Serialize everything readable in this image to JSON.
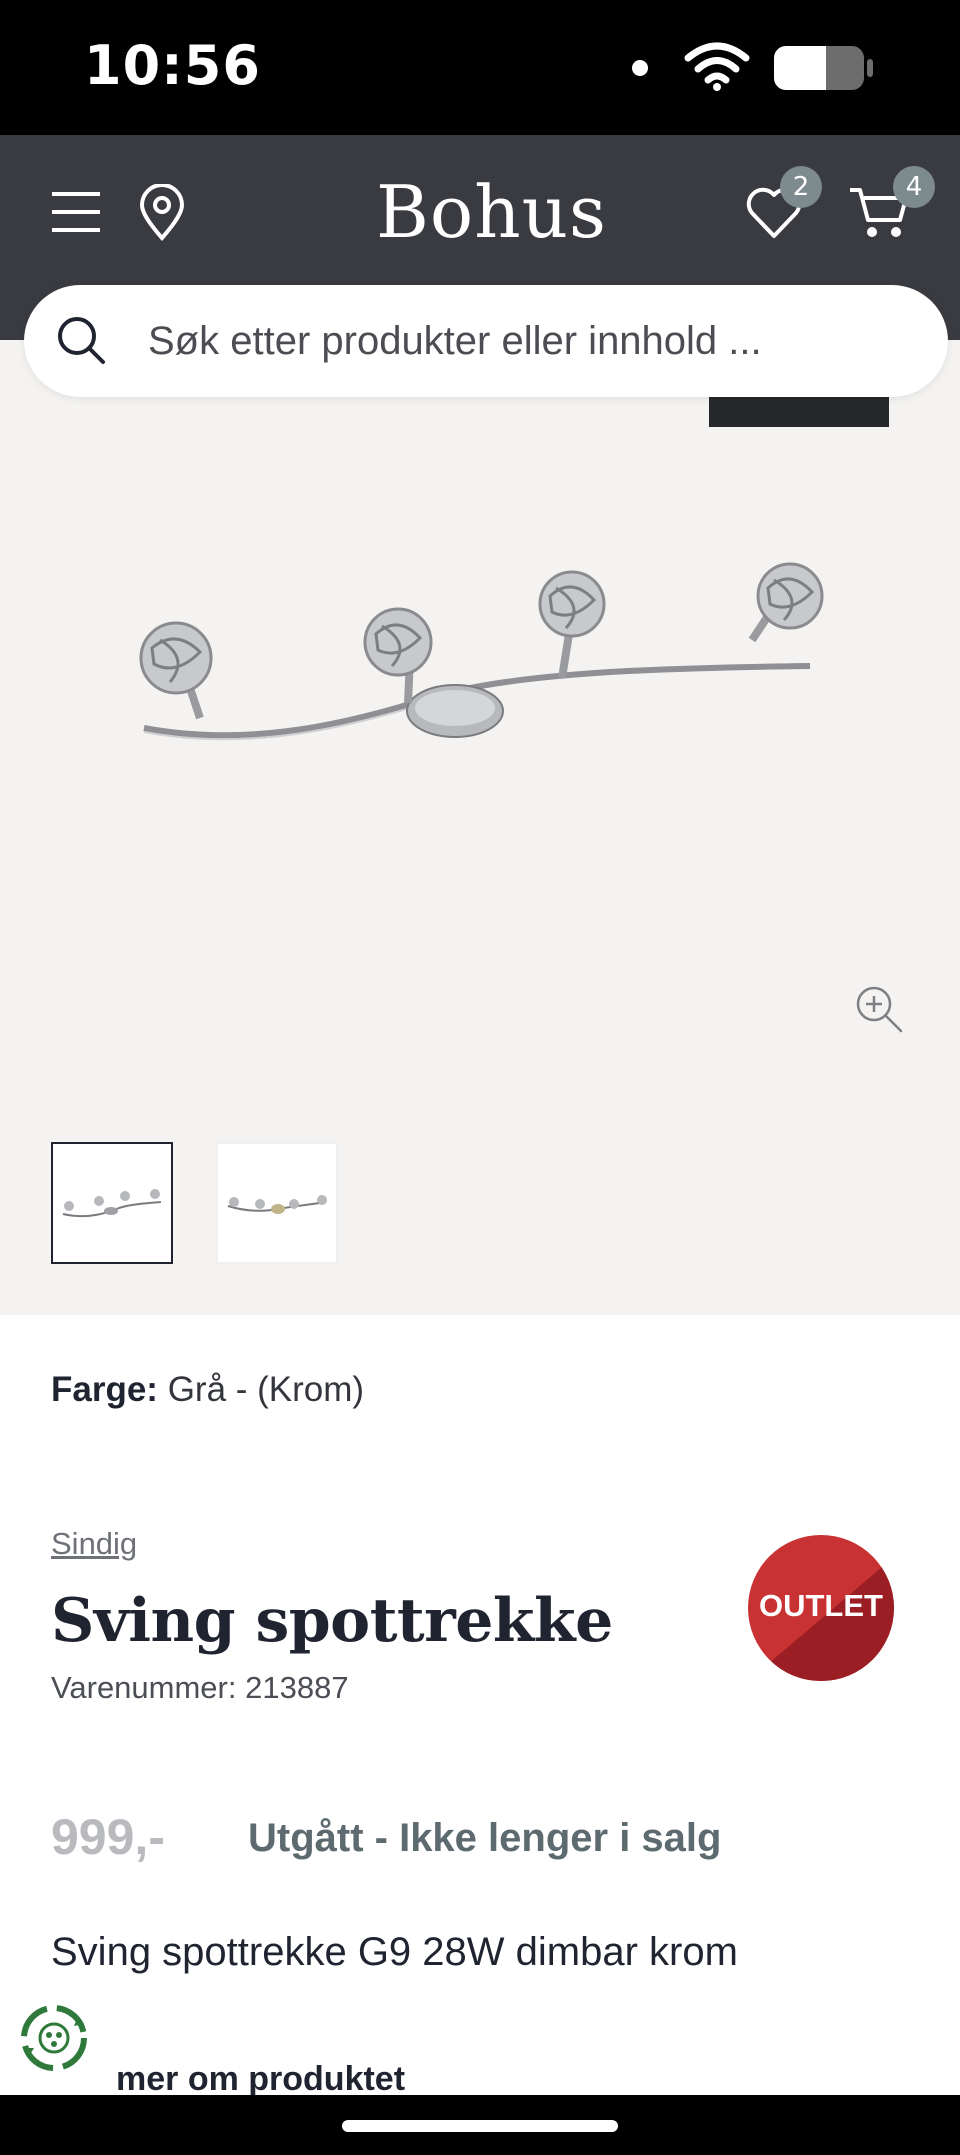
{
  "status_bar": {
    "time": "10:56"
  },
  "header": {
    "logo": "Bohus",
    "wishlist_count": "2",
    "cart_count": "4"
  },
  "search": {
    "placeholder": "Søk etter produkter eller innhold ..."
  },
  "product": {
    "color_label": "Farge:",
    "color_value": "Grå - (Krom)",
    "brand": "Sindig",
    "title": "Sving spottrekke",
    "sku_label": "Varenummer:",
    "sku_value": "213887",
    "badge": "OUTLET",
    "price": "999,-",
    "stock_status": "Utgått - Ikke lenger i salg",
    "short_description": "Sving spottrekke G9 28W dimbar krom",
    "more_link": "mer om produktet"
  },
  "gallery": {
    "thumbnail_count": 2,
    "selected_thumbnail": 1
  },
  "colors": {
    "header_bg": "#3a3b40",
    "badge_bg": "#7d8a8e",
    "outlet_red": "#c93232",
    "stock_status": "#5d6b70"
  },
  "icons": [
    "menu-icon",
    "location-icon",
    "heart-icon",
    "cart-icon",
    "search-icon",
    "zoom-icon",
    "recycle-icon"
  ]
}
